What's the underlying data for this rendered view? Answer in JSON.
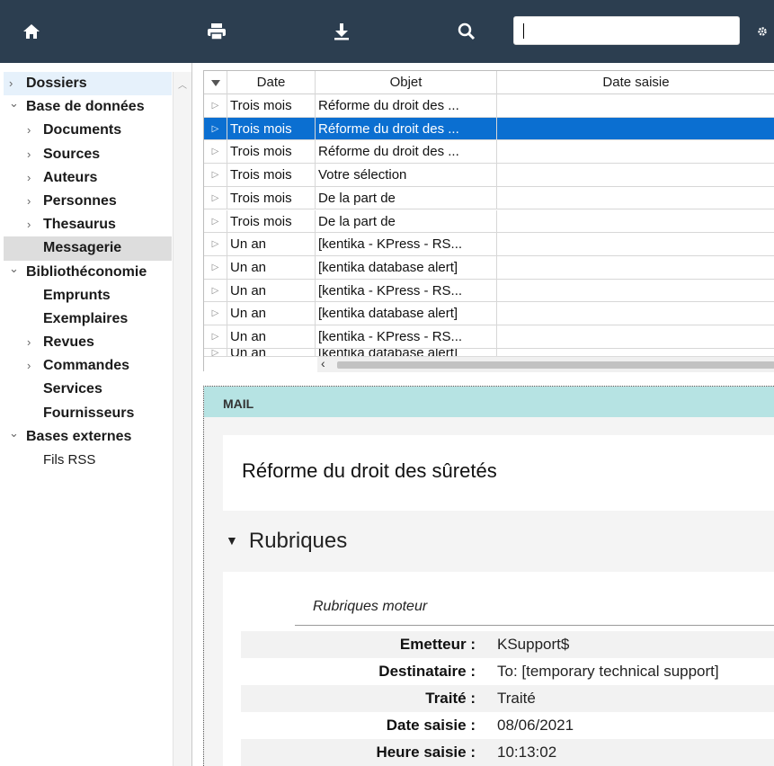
{
  "toolbar": {
    "search_value": ""
  },
  "sidebar": {
    "items": [
      {
        "label": "Dossiers",
        "chevron": "›"
      },
      {
        "label": "Base de données",
        "chevron": "⌄"
      },
      {
        "label": "Documents",
        "chevron": "›"
      },
      {
        "label": "Sources",
        "chevron": "›"
      },
      {
        "label": "Auteurs",
        "chevron": "›"
      },
      {
        "label": "Personnes",
        "chevron": "›"
      },
      {
        "label": "Thesaurus",
        "chevron": "›"
      },
      {
        "label": "Messagerie",
        "chevron": ""
      },
      {
        "label": "Bibliothéconomie",
        "chevron": "⌄"
      },
      {
        "label": "Emprunts",
        "chevron": ""
      },
      {
        "label": "Exemplaires",
        "chevron": ""
      },
      {
        "label": "Revues",
        "chevron": "›"
      },
      {
        "label": "Commandes",
        "chevron": "›"
      },
      {
        "label": "Services",
        "chevron": ""
      },
      {
        "label": "Fournisseurs",
        "chevron": ""
      },
      {
        "label": "Bases externes",
        "chevron": "⌄"
      },
      {
        "label": "Fils RSS",
        "chevron": ""
      }
    ]
  },
  "grid": {
    "columns": [
      "Date",
      "Objet",
      "Date saisie"
    ],
    "rows": [
      {
        "date": "Trois mois",
        "objet": "Réforme du droit des ..."
      },
      {
        "date": "Trois mois",
        "objet": "Réforme du droit des ..."
      },
      {
        "date": "Trois mois",
        "objet": "Réforme du droit des ..."
      },
      {
        "date": "Trois mois",
        "objet": "Votre sélection"
      },
      {
        "date": "Trois mois",
        "objet": "De la part de"
      },
      {
        "date": "Trois mois",
        "objet": "De la part de"
      },
      {
        "date": "Un an",
        "objet": "[kentika - KPress - RS..."
      },
      {
        "date": "Un an",
        "objet": "[kentika database alert]"
      },
      {
        "date": "Un an",
        "objet": "[kentika - KPress - RS..."
      },
      {
        "date": "Un an",
        "objet": "[kentika database alert]"
      },
      {
        "date": "Un an",
        "objet": "[kentika - KPress - RS..."
      },
      {
        "date": "Un an",
        "objet": "[kentika database alert]"
      }
    ]
  },
  "detail": {
    "section_label": "MAIL",
    "title": "Réforme du droit des sûretés",
    "rubriques_heading": "Rubriques",
    "rubriques_moteur": "Rubriques moteur",
    "fields": [
      {
        "key": "Emetteur :",
        "value": "KSupport$"
      },
      {
        "key": "Destinataire :",
        "value": "To: [temporary technical support]"
      },
      {
        "key": "Traité :",
        "value": "Traité"
      },
      {
        "key": "Date saisie :",
        "value": "08/06/2021"
      },
      {
        "key": "Heure saisie :",
        "value": "10:13:02"
      }
    ]
  },
  "colors": {
    "toolbar_bg": "#2c3e50",
    "selection": "#0b6fd1",
    "mail_bar": "#b6e3e3",
    "sidebar_active_bg": "#dddddd",
    "sidebar_hover_bg": "#e6f1fb"
  }
}
